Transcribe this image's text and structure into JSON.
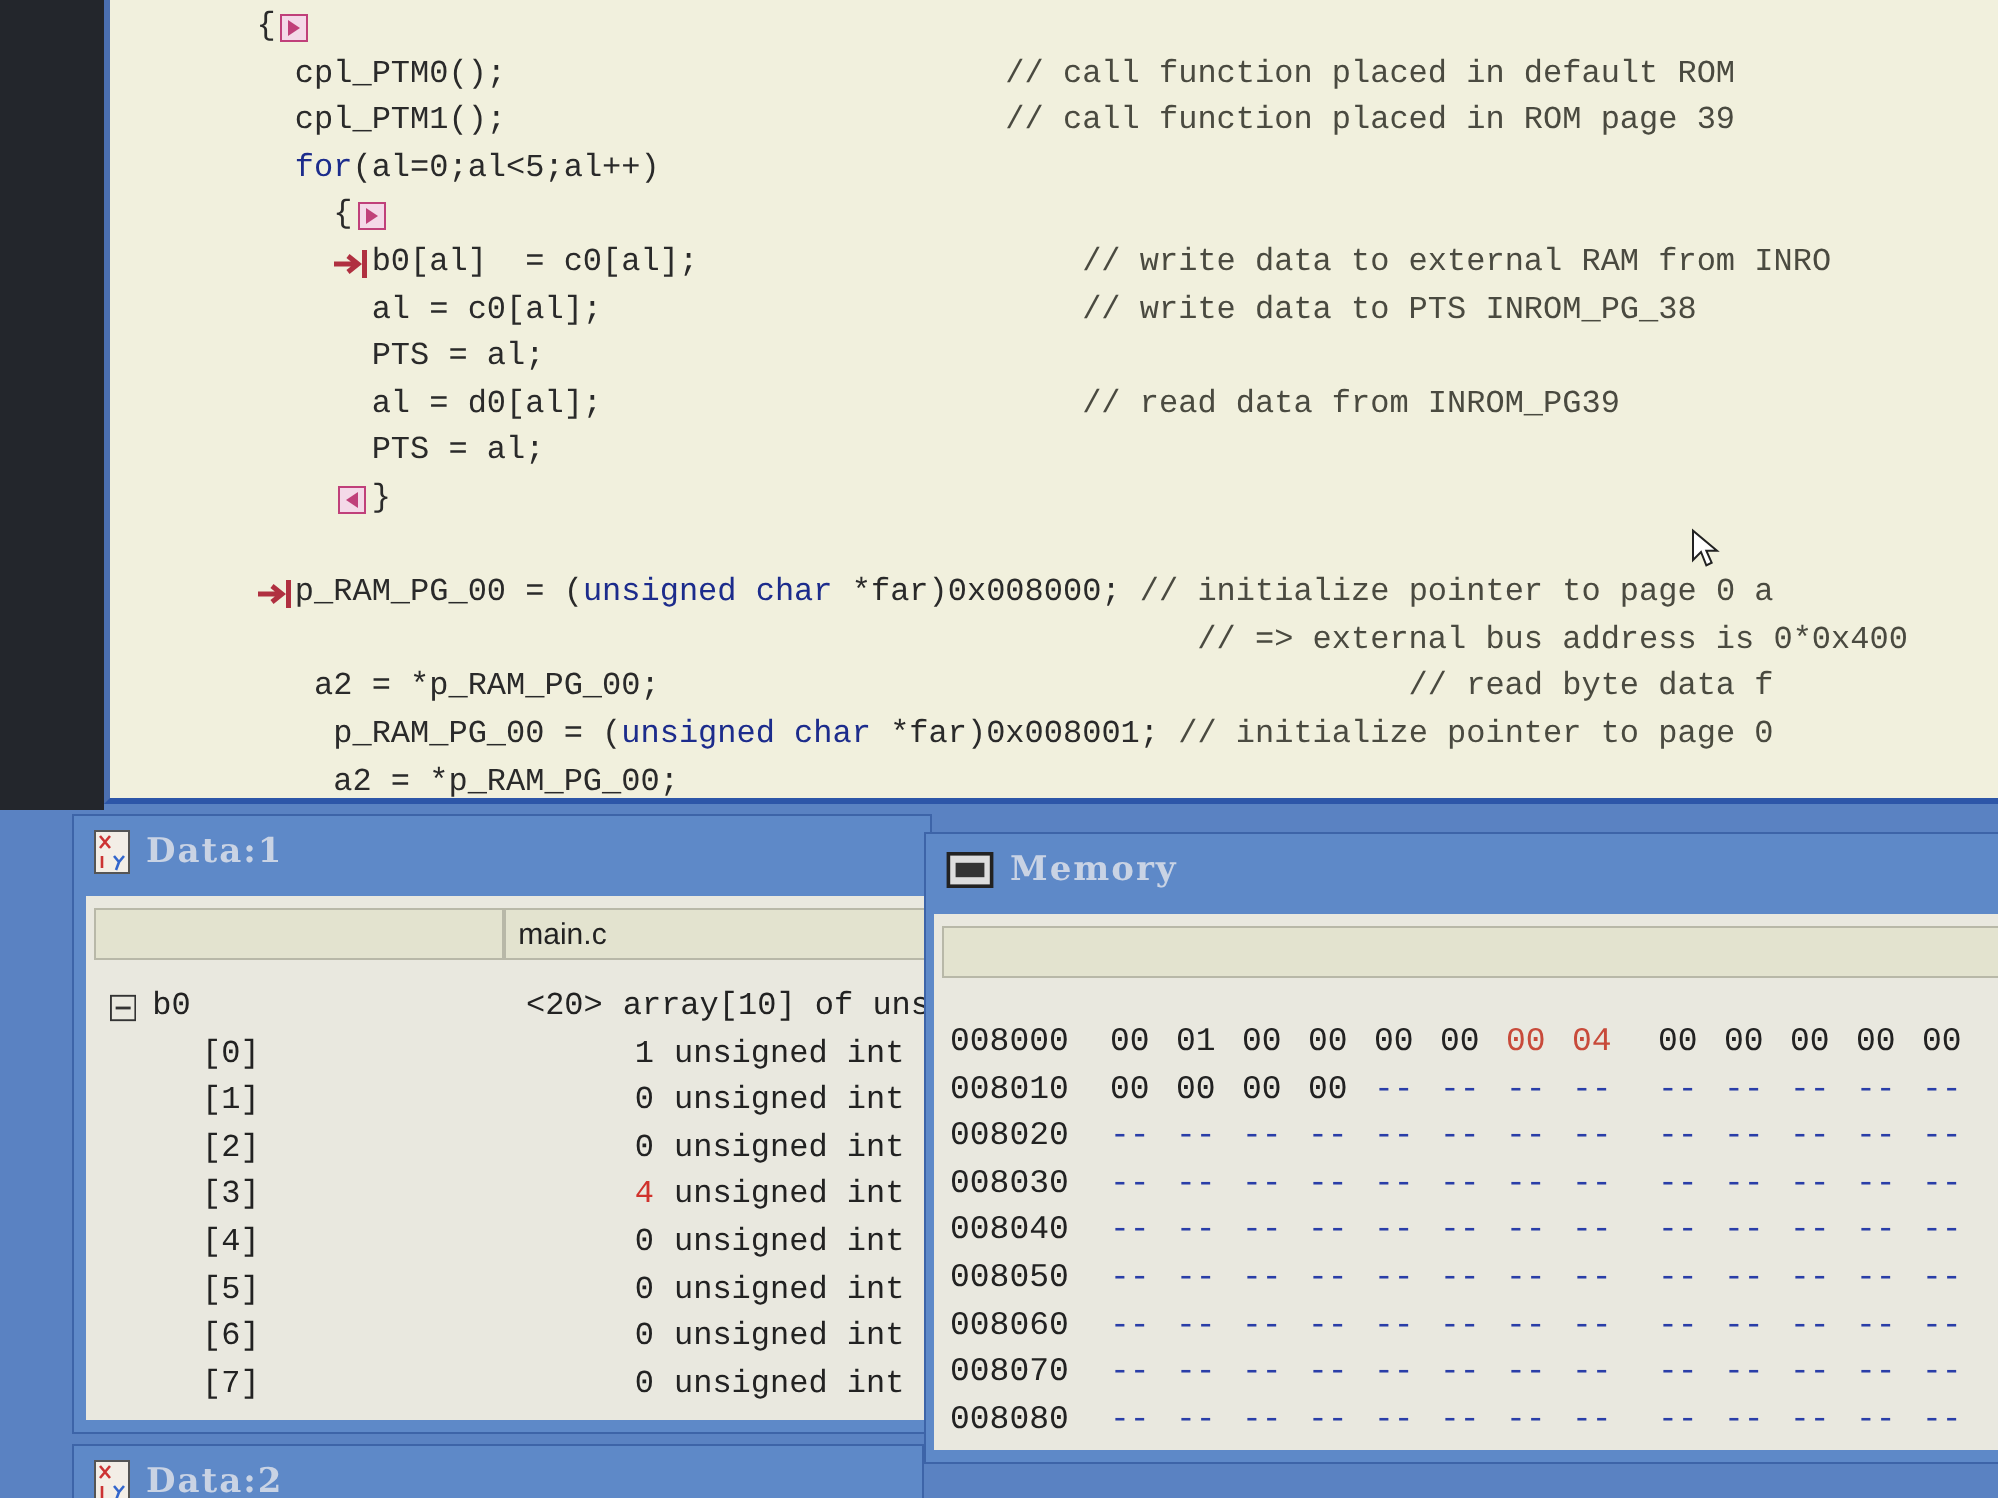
{
  "editor": {
    "lines": [
      {
        "segments": [
          {
            "kind": "code",
            "text": "{"
          },
          {
            "kind": "fold-open"
          }
        ],
        "children": [
          {
            "segments": [
              {
                "kind": "code",
                "text": "cpl_PTM0();                          "
              },
              {
                "kind": "comment",
                "text": "// call function placed in default ROM"
              }
            ]
          },
          {
            "segments": [
              {
                "kind": "code",
                "text": "cpl_PTM1();                          "
              },
              {
                "kind": "comment",
                "text": "// call function placed in ROM page 39"
              }
            ]
          },
          {
            "segments": [
              {
                "kind": "keyword",
                "text": "for"
              },
              {
                "kind": "code",
                "text": "(al=0;al<5;al++)"
              }
            ],
            "children": [
              {
                "segments": [
                  {
                    "kind": "code",
                    "text": "{"
                  },
                  {
                    "kind": "fold-open"
                  }
                ],
                "children": [
                  {
                    "segments": [
                      {
                        "kind": "arrow"
                      },
                      {
                        "kind": "code",
                        "text": "b0[al]  = c0[al];                    "
                      },
                      {
                        "kind": "comment",
                        "text": "// write data to external RAM from INRO"
                      }
                    ]
                  },
                  {
                    "segments": [
                      {
                        "kind": "code",
                        "text": "al = c0[al];                         "
                      },
                      {
                        "kind": "comment",
                        "text": "// write data to PTS INROM_PG_38"
                      }
                    ]
                  },
                  {
                    "segments": [
                      {
                        "kind": "code",
                        "text": "PTS = al;"
                      }
                    ]
                  },
                  {
                    "segments": [
                      {
                        "kind": "code",
                        "text": "al = d0[al];                         "
                      },
                      {
                        "kind": "comment",
                        "text": "// read data from INROM_PG39"
                      }
                    ]
                  },
                  {
                    "segments": [
                      {
                        "kind": "code",
                        "text": "PTS = al;"
                      }
                    ]
                  },
                  {
                    "segments": [
                      {
                        "kind": "fold-close"
                      },
                      {
                        "kind": "code",
                        "text": "}"
                      }
                    ]
                  }
                ]
              }
            ]
          },
          {
            "blank": true
          },
          {
            "segments": [
              {
                "kind": "arrow"
              },
              {
                "kind": "code",
                "text": "p_RAM_PG_00 = ("
              },
              {
                "kind": "keyword",
                "text": "unsigned char"
              },
              {
                "kind": "code",
                "text": " *far)0x008000; "
              },
              {
                "kind": "comment",
                "text": "// initialize pointer to page 0 a"
              }
            ]
          },
          {
            "segments": [
              {
                "kind": "comment",
                "text": "                                               // => external bus address is 0*0x400"
              }
            ]
          },
          {
            "segments": [
              {
                "kind": "code",
                "text": " a2 = *p_RAM_PG_00;                                       "
              },
              {
                "kind": "comment",
                "text": "// read byte data f"
              }
            ]
          },
          {
            "segments": [
              {
                "kind": "code",
                "text": "  p_RAM_PG_00 = ("
              },
              {
                "kind": "keyword",
                "text": "unsigned char"
              },
              {
                "kind": "code",
                "text": " *far)0x008001; "
              },
              {
                "kind": "comment",
                "text": "// initialize pointer to page 0"
              }
            ]
          },
          {
            "segments": [
              {
                "kind": "code",
                "text": "  a2 = *p_RAM_PG_00;"
              }
            ]
          }
        ]
      }
    ]
  },
  "data_window": {
    "title": "Data:1",
    "header": {
      "column_2": "main.c"
    },
    "tree": [
      {
        "name": "b0",
        "expanded": true,
        "value": "<20>",
        "type": "array[10] of uns",
        "changed": false,
        "children": [
          {
            "name": "[0]",
            "value": "1",
            "type": "unsigned int",
            "changed": false
          },
          {
            "name": "[1]",
            "value": "0",
            "type": "unsigned int",
            "changed": false
          },
          {
            "name": "[2]",
            "value": "0",
            "type": "unsigned int",
            "changed": false
          },
          {
            "name": "[3]",
            "value": "4",
            "type": "unsigned int",
            "changed": true
          },
          {
            "name": "[4]",
            "value": "0",
            "type": "unsigned int",
            "changed": false
          },
          {
            "name": "[5]",
            "value": "0",
            "type": "unsigned int",
            "changed": false
          },
          {
            "name": "[6]",
            "value": "0",
            "type": "unsigned int",
            "changed": false
          },
          {
            "name": "[7]",
            "value": "0",
            "type": "unsigned int",
            "changed": false
          }
        ]
      }
    ]
  },
  "memory_window": {
    "title": "Memory",
    "rows": [
      {
        "address": "008000",
        "bytes": [
          {
            "t": "00",
            "changed": false,
            "valid": true
          },
          {
            "t": "01",
            "changed": false,
            "valid": true
          },
          {
            "t": "00",
            "changed": false,
            "valid": true
          },
          {
            "t": "00",
            "changed": false,
            "valid": true
          },
          {
            "t": "00",
            "changed": false,
            "valid": true
          },
          {
            "t": "00",
            "changed": false,
            "valid": true
          },
          {
            "t": "00",
            "changed": true,
            "valid": true
          },
          {
            "t": "04",
            "changed": true,
            "valid": true
          },
          {
            "t": "00",
            "changed": false,
            "valid": true
          },
          {
            "t": "00",
            "changed": false,
            "valid": true
          },
          {
            "t": "00",
            "changed": false,
            "valid": true
          },
          {
            "t": "00",
            "changed": false,
            "valid": true
          },
          {
            "t": "00",
            "changed": false,
            "valid": true
          }
        ]
      },
      {
        "address": "008010",
        "bytes": [
          {
            "t": "00",
            "changed": false,
            "valid": true
          },
          {
            "t": "00",
            "changed": false,
            "valid": true
          },
          {
            "t": "00",
            "changed": false,
            "valid": true
          },
          {
            "t": "00",
            "changed": false,
            "valid": true
          },
          {
            "t": "--",
            "changed": false,
            "valid": false
          },
          {
            "t": "--",
            "changed": false,
            "valid": false
          },
          {
            "t": "--",
            "changed": false,
            "valid": false
          },
          {
            "t": "--",
            "changed": false,
            "valid": false
          },
          {
            "t": "--",
            "changed": false,
            "valid": false
          },
          {
            "t": "--",
            "changed": false,
            "valid": false
          },
          {
            "t": "--",
            "changed": false,
            "valid": false
          },
          {
            "t": "--",
            "changed": false,
            "valid": false
          },
          {
            "t": "--",
            "changed": false,
            "valid": false
          }
        ]
      },
      {
        "address": "008020",
        "bytes": [
          {
            "t": "--",
            "changed": false,
            "valid": false
          },
          {
            "t": "--",
            "changed": false,
            "valid": false
          },
          {
            "t": "--",
            "changed": false,
            "valid": false
          },
          {
            "t": "--",
            "changed": false,
            "valid": false
          },
          {
            "t": "--",
            "changed": false,
            "valid": false
          },
          {
            "t": "--",
            "changed": false,
            "valid": false
          },
          {
            "t": "--",
            "changed": false,
            "valid": false
          },
          {
            "t": "--",
            "changed": false,
            "valid": false
          },
          {
            "t": "--",
            "changed": false,
            "valid": false
          },
          {
            "t": "--",
            "changed": false,
            "valid": false
          },
          {
            "t": "--",
            "changed": false,
            "valid": false
          },
          {
            "t": "--",
            "changed": false,
            "valid": false
          },
          {
            "t": "--",
            "changed": false,
            "valid": false
          }
        ]
      },
      {
        "address": "008030",
        "bytes": [
          {
            "t": "--",
            "changed": false,
            "valid": false
          },
          {
            "t": "--",
            "changed": false,
            "valid": false
          },
          {
            "t": "--",
            "changed": false,
            "valid": false
          },
          {
            "t": "--",
            "changed": false,
            "valid": false
          },
          {
            "t": "--",
            "changed": false,
            "valid": false
          },
          {
            "t": "--",
            "changed": false,
            "valid": false
          },
          {
            "t": "--",
            "changed": false,
            "valid": false
          },
          {
            "t": "--",
            "changed": false,
            "valid": false
          },
          {
            "t": "--",
            "changed": false,
            "valid": false
          },
          {
            "t": "--",
            "changed": false,
            "valid": false
          },
          {
            "t": "--",
            "changed": false,
            "valid": false
          },
          {
            "t": "--",
            "changed": false,
            "valid": false
          },
          {
            "t": "--",
            "changed": false,
            "valid": false
          }
        ]
      },
      {
        "address": "008040",
        "bytes": [
          {
            "t": "--",
            "changed": false,
            "valid": false
          },
          {
            "t": "--",
            "changed": false,
            "valid": false
          },
          {
            "t": "--",
            "changed": false,
            "valid": false
          },
          {
            "t": "--",
            "changed": false,
            "valid": false
          },
          {
            "t": "--",
            "changed": false,
            "valid": false
          },
          {
            "t": "--",
            "changed": false,
            "valid": false
          },
          {
            "t": "--",
            "changed": false,
            "valid": false
          },
          {
            "t": "--",
            "changed": false,
            "valid": false
          },
          {
            "t": "--",
            "changed": false,
            "valid": false
          },
          {
            "t": "--",
            "changed": false,
            "valid": false
          },
          {
            "t": "--",
            "changed": false,
            "valid": false
          },
          {
            "t": "--",
            "changed": false,
            "valid": false
          },
          {
            "t": "--",
            "changed": false,
            "valid": false
          }
        ]
      },
      {
        "address": "008050",
        "bytes": [
          {
            "t": "--",
            "changed": false,
            "valid": false
          },
          {
            "t": "--",
            "changed": false,
            "valid": false
          },
          {
            "t": "--",
            "changed": false,
            "valid": false
          },
          {
            "t": "--",
            "changed": false,
            "valid": false
          },
          {
            "t": "--",
            "changed": false,
            "valid": false
          },
          {
            "t": "--",
            "changed": false,
            "valid": false
          },
          {
            "t": "--",
            "changed": false,
            "valid": false
          },
          {
            "t": "--",
            "changed": false,
            "valid": false
          },
          {
            "t": "--",
            "changed": false,
            "valid": false
          },
          {
            "t": "--",
            "changed": false,
            "valid": false
          },
          {
            "t": "--",
            "changed": false,
            "valid": false
          },
          {
            "t": "--",
            "changed": false,
            "valid": false
          },
          {
            "t": "--",
            "changed": false,
            "valid": false
          }
        ]
      },
      {
        "address": "008060",
        "bytes": [
          {
            "t": "--",
            "changed": false,
            "valid": false
          },
          {
            "t": "--",
            "changed": false,
            "valid": false
          },
          {
            "t": "--",
            "changed": false,
            "valid": false
          },
          {
            "t": "--",
            "changed": false,
            "valid": false
          },
          {
            "t": "--",
            "changed": false,
            "valid": false
          },
          {
            "t": "--",
            "changed": false,
            "valid": false
          },
          {
            "t": "--",
            "changed": false,
            "valid": false
          },
          {
            "t": "--",
            "changed": false,
            "valid": false
          },
          {
            "t": "--",
            "changed": false,
            "valid": false
          },
          {
            "t": "--",
            "changed": false,
            "valid": false
          },
          {
            "t": "--",
            "changed": false,
            "valid": false
          },
          {
            "t": "--",
            "changed": false,
            "valid": false
          },
          {
            "t": "--",
            "changed": false,
            "valid": false
          }
        ]
      },
      {
        "address": "008070",
        "bytes": [
          {
            "t": "--",
            "changed": false,
            "valid": false
          },
          {
            "t": "--",
            "changed": false,
            "valid": false
          },
          {
            "t": "--",
            "changed": false,
            "valid": false
          },
          {
            "t": "--",
            "changed": false,
            "valid": false
          },
          {
            "t": "--",
            "changed": false,
            "valid": false
          },
          {
            "t": "--",
            "changed": false,
            "valid": false
          },
          {
            "t": "--",
            "changed": false,
            "valid": false
          },
          {
            "t": "--",
            "changed": false,
            "valid": false
          },
          {
            "t": "--",
            "changed": false,
            "valid": false
          },
          {
            "t": "--",
            "changed": false,
            "valid": false
          },
          {
            "t": "--",
            "changed": false,
            "valid": false
          },
          {
            "t": "--",
            "changed": false,
            "valid": false
          },
          {
            "t": "--",
            "changed": false,
            "valid": false
          }
        ]
      },
      {
        "address": "008080",
        "bytes": [
          {
            "t": "--",
            "changed": false,
            "valid": false
          },
          {
            "t": "--",
            "changed": false,
            "valid": false
          },
          {
            "t": "--",
            "changed": false,
            "valid": false
          },
          {
            "t": "--",
            "changed": false,
            "valid": false
          },
          {
            "t": "--",
            "changed": false,
            "valid": false
          },
          {
            "t": "--",
            "changed": false,
            "valid": false
          },
          {
            "t": "--",
            "changed": false,
            "valid": false
          },
          {
            "t": "--",
            "changed": false,
            "valid": false
          },
          {
            "t": "--",
            "changed": false,
            "valid": false
          },
          {
            "t": "--",
            "changed": false,
            "valid": false
          },
          {
            "t": "--",
            "changed": false,
            "valid": false
          },
          {
            "t": "--",
            "changed": false,
            "valid": false
          },
          {
            "t": "--",
            "changed": false,
            "valid": false
          }
        ]
      }
    ]
  },
  "second_data_window": {
    "title": "Data:2"
  }
}
